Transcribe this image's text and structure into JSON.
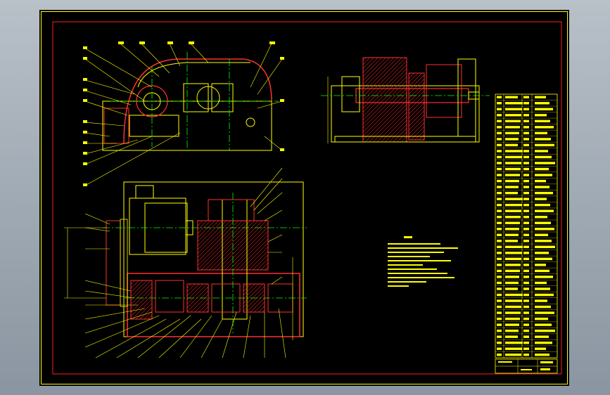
{
  "colors": {
    "app_background": "#a2abb5",
    "canvas": "#000000",
    "frame_outer": "#ffff00",
    "frame_inner": "#ff0000",
    "outline": "#ffff00",
    "section": "#ff2a2a",
    "centerline": "#00ff00",
    "hatch": "#ff2a2a",
    "table_text": "#ffff00"
  },
  "views": [
    {
      "name": "front-view",
      "type": "gearbox-front-section"
    },
    {
      "name": "top-view",
      "type": "gearbox-plan-section"
    },
    {
      "name": "side-view",
      "type": "shaft-assembly-section"
    }
  ],
  "table": {
    "rows": 44,
    "columns": 4
  }
}
